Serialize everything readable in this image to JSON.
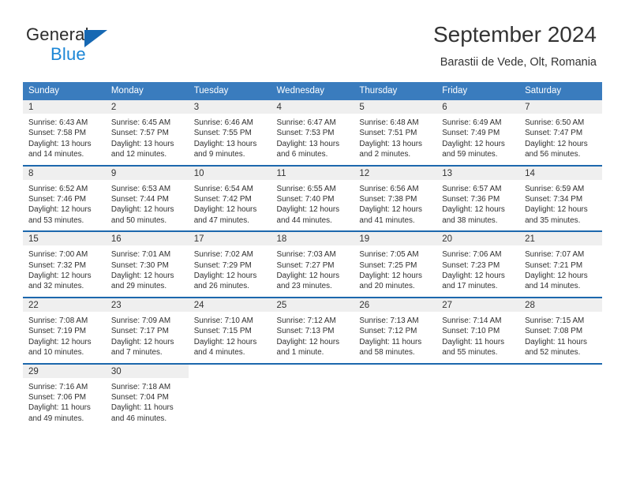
{
  "brand": {
    "name_top": "General",
    "name_bottom": "Blue",
    "logo_icon": "triangle-icon",
    "accent_color": "#1668b3",
    "blue_text_color": "#1b86d6"
  },
  "header": {
    "title": "September 2024",
    "location": "Barastii de Vede, Olt, Romania"
  },
  "colors": {
    "header_row_bg": "#3a7cbe",
    "week_divider": "#1d68ad",
    "date_band_bg": "#efefef",
    "text": "#303030"
  },
  "weekdays": [
    "Sunday",
    "Monday",
    "Tuesday",
    "Wednesday",
    "Thursday",
    "Friday",
    "Saturday"
  ],
  "weeks": [
    [
      {
        "day": "1",
        "sunrise": "Sunrise: 6:43 AM",
        "sunset": "Sunset: 7:58 PM",
        "daylight_1": "Daylight: 13 hours",
        "daylight_2": "and 14 minutes."
      },
      {
        "day": "2",
        "sunrise": "Sunrise: 6:45 AM",
        "sunset": "Sunset: 7:57 PM",
        "daylight_1": "Daylight: 13 hours",
        "daylight_2": "and 12 minutes."
      },
      {
        "day": "3",
        "sunrise": "Sunrise: 6:46 AM",
        "sunset": "Sunset: 7:55 PM",
        "daylight_1": "Daylight: 13 hours",
        "daylight_2": "and 9 minutes."
      },
      {
        "day": "4",
        "sunrise": "Sunrise: 6:47 AM",
        "sunset": "Sunset: 7:53 PM",
        "daylight_1": "Daylight: 13 hours",
        "daylight_2": "and 6 minutes."
      },
      {
        "day": "5",
        "sunrise": "Sunrise: 6:48 AM",
        "sunset": "Sunset: 7:51 PM",
        "daylight_1": "Daylight: 13 hours",
        "daylight_2": "and 2 minutes."
      },
      {
        "day": "6",
        "sunrise": "Sunrise: 6:49 AM",
        "sunset": "Sunset: 7:49 PM",
        "daylight_1": "Daylight: 12 hours",
        "daylight_2": "and 59 minutes."
      },
      {
        "day": "7",
        "sunrise": "Sunrise: 6:50 AM",
        "sunset": "Sunset: 7:47 PM",
        "daylight_1": "Daylight: 12 hours",
        "daylight_2": "and 56 minutes."
      }
    ],
    [
      {
        "day": "8",
        "sunrise": "Sunrise: 6:52 AM",
        "sunset": "Sunset: 7:46 PM",
        "daylight_1": "Daylight: 12 hours",
        "daylight_2": "and 53 minutes."
      },
      {
        "day": "9",
        "sunrise": "Sunrise: 6:53 AM",
        "sunset": "Sunset: 7:44 PM",
        "daylight_1": "Daylight: 12 hours",
        "daylight_2": "and 50 minutes."
      },
      {
        "day": "10",
        "sunrise": "Sunrise: 6:54 AM",
        "sunset": "Sunset: 7:42 PM",
        "daylight_1": "Daylight: 12 hours",
        "daylight_2": "and 47 minutes."
      },
      {
        "day": "11",
        "sunrise": "Sunrise: 6:55 AM",
        "sunset": "Sunset: 7:40 PM",
        "daylight_1": "Daylight: 12 hours",
        "daylight_2": "and 44 minutes."
      },
      {
        "day": "12",
        "sunrise": "Sunrise: 6:56 AM",
        "sunset": "Sunset: 7:38 PM",
        "daylight_1": "Daylight: 12 hours",
        "daylight_2": "and 41 minutes."
      },
      {
        "day": "13",
        "sunrise": "Sunrise: 6:57 AM",
        "sunset": "Sunset: 7:36 PM",
        "daylight_1": "Daylight: 12 hours",
        "daylight_2": "and 38 minutes."
      },
      {
        "day": "14",
        "sunrise": "Sunrise: 6:59 AM",
        "sunset": "Sunset: 7:34 PM",
        "daylight_1": "Daylight: 12 hours",
        "daylight_2": "and 35 minutes."
      }
    ],
    [
      {
        "day": "15",
        "sunrise": "Sunrise: 7:00 AM",
        "sunset": "Sunset: 7:32 PM",
        "daylight_1": "Daylight: 12 hours",
        "daylight_2": "and 32 minutes."
      },
      {
        "day": "16",
        "sunrise": "Sunrise: 7:01 AM",
        "sunset": "Sunset: 7:30 PM",
        "daylight_1": "Daylight: 12 hours",
        "daylight_2": "and 29 minutes."
      },
      {
        "day": "17",
        "sunrise": "Sunrise: 7:02 AM",
        "sunset": "Sunset: 7:29 PM",
        "daylight_1": "Daylight: 12 hours",
        "daylight_2": "and 26 minutes."
      },
      {
        "day": "18",
        "sunrise": "Sunrise: 7:03 AM",
        "sunset": "Sunset: 7:27 PM",
        "daylight_1": "Daylight: 12 hours",
        "daylight_2": "and 23 minutes."
      },
      {
        "day": "19",
        "sunrise": "Sunrise: 7:05 AM",
        "sunset": "Sunset: 7:25 PM",
        "daylight_1": "Daylight: 12 hours",
        "daylight_2": "and 20 minutes."
      },
      {
        "day": "20",
        "sunrise": "Sunrise: 7:06 AM",
        "sunset": "Sunset: 7:23 PM",
        "daylight_1": "Daylight: 12 hours",
        "daylight_2": "and 17 minutes."
      },
      {
        "day": "21",
        "sunrise": "Sunrise: 7:07 AM",
        "sunset": "Sunset: 7:21 PM",
        "daylight_1": "Daylight: 12 hours",
        "daylight_2": "and 14 minutes."
      }
    ],
    [
      {
        "day": "22",
        "sunrise": "Sunrise: 7:08 AM",
        "sunset": "Sunset: 7:19 PM",
        "daylight_1": "Daylight: 12 hours",
        "daylight_2": "and 10 minutes."
      },
      {
        "day": "23",
        "sunrise": "Sunrise: 7:09 AM",
        "sunset": "Sunset: 7:17 PM",
        "daylight_1": "Daylight: 12 hours",
        "daylight_2": "and 7 minutes."
      },
      {
        "day": "24",
        "sunrise": "Sunrise: 7:10 AM",
        "sunset": "Sunset: 7:15 PM",
        "daylight_1": "Daylight: 12 hours",
        "daylight_2": "and 4 minutes."
      },
      {
        "day": "25",
        "sunrise": "Sunrise: 7:12 AM",
        "sunset": "Sunset: 7:13 PM",
        "daylight_1": "Daylight: 12 hours",
        "daylight_2": "and 1 minute."
      },
      {
        "day": "26",
        "sunrise": "Sunrise: 7:13 AM",
        "sunset": "Sunset: 7:12 PM",
        "daylight_1": "Daylight: 11 hours",
        "daylight_2": "and 58 minutes."
      },
      {
        "day": "27",
        "sunrise": "Sunrise: 7:14 AM",
        "sunset": "Sunset: 7:10 PM",
        "daylight_1": "Daylight: 11 hours",
        "daylight_2": "and 55 minutes."
      },
      {
        "day": "28",
        "sunrise": "Sunrise: 7:15 AM",
        "sunset": "Sunset: 7:08 PM",
        "daylight_1": "Daylight: 11 hours",
        "daylight_2": "and 52 minutes."
      }
    ],
    [
      {
        "day": "29",
        "sunrise": "Sunrise: 7:16 AM",
        "sunset": "Sunset: 7:06 PM",
        "daylight_1": "Daylight: 11 hours",
        "daylight_2": "and 49 minutes."
      },
      {
        "day": "30",
        "sunrise": "Sunrise: 7:18 AM",
        "sunset": "Sunset: 7:04 PM",
        "daylight_1": "Daylight: 11 hours",
        "daylight_2": "and 46 minutes."
      },
      {
        "day": "",
        "sunrise": "",
        "sunset": "",
        "daylight_1": "",
        "daylight_2": ""
      },
      {
        "day": "",
        "sunrise": "",
        "sunset": "",
        "daylight_1": "",
        "daylight_2": ""
      },
      {
        "day": "",
        "sunrise": "",
        "sunset": "",
        "daylight_1": "",
        "daylight_2": ""
      },
      {
        "day": "",
        "sunrise": "",
        "sunset": "",
        "daylight_1": "",
        "daylight_2": ""
      },
      {
        "day": "",
        "sunrise": "",
        "sunset": "",
        "daylight_1": "",
        "daylight_2": ""
      }
    ]
  ]
}
